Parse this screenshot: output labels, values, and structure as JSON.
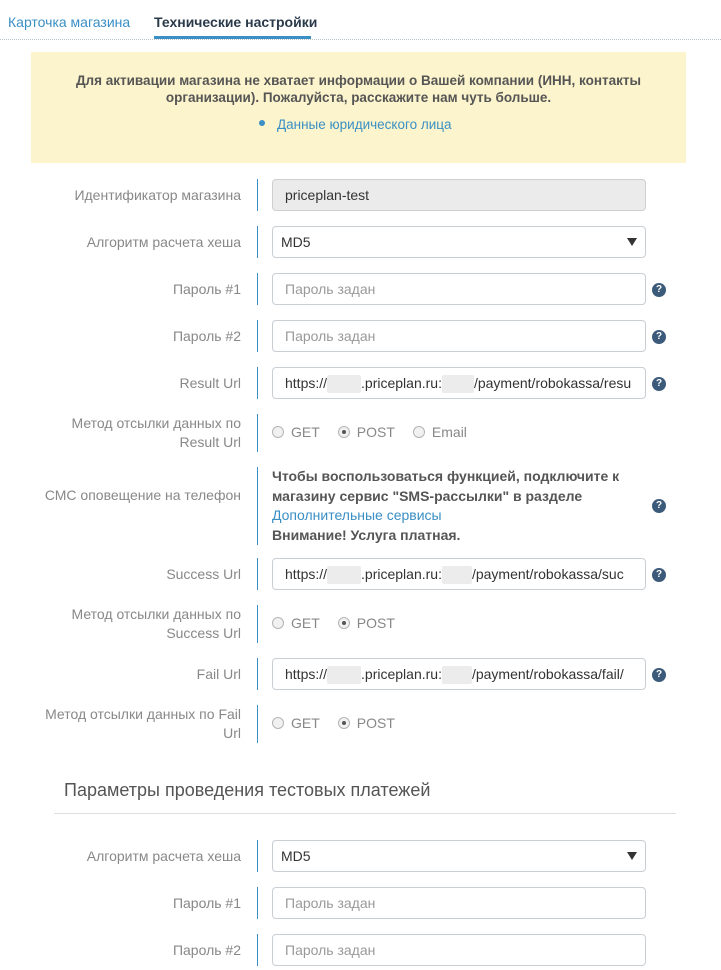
{
  "tabs": [
    {
      "label": "Карточка магазина",
      "active": false
    },
    {
      "label": "Технические настройки",
      "active": true
    }
  ],
  "alert": {
    "text": "Для активации магазина не хватает информации о Вашей компании (ИНН, контакты организации). Пожалуйста, расскажите нам чуть больше.",
    "link": "Данные юридического лица"
  },
  "form": {
    "shop_id": {
      "label": "Идентификатор магазина",
      "value": "priceplan-test"
    },
    "hash_algo": {
      "label": "Алгоритм расчета хеша",
      "value": "MD5"
    },
    "password1": {
      "label": "Пароль #1",
      "placeholder": "Пароль задан"
    },
    "password2": {
      "label": "Пароль #2",
      "placeholder": "Пароль задан"
    },
    "result_url": {
      "label": "Result Url",
      "prefix": "https://",
      "mid": ".priceplan.ru:",
      "suffix": "/payment/robokassa/resu"
    },
    "result_method": {
      "label": "Метод отсылки данных по Result Url",
      "options": [
        "GET",
        "POST",
        "Email"
      ],
      "selected": "POST"
    },
    "sms": {
      "label": "СМС оповещение на телефон",
      "text": "Чтобы воспользоваться функцией, подключите к магазину сервис \"SMS-рассылки\" в разделе",
      "link": "Дополнительные сервисы",
      "warning": "Внимание! Услуга платная."
    },
    "success_url": {
      "label": "Success Url",
      "prefix": "https://",
      "mid": ".priceplan.ru:",
      "suffix": "/payment/robokassa/suc"
    },
    "success_method": {
      "label": "Метод отсылки данных по Success Url",
      "options": [
        "GET",
        "POST"
      ],
      "selected": "POST"
    },
    "fail_url": {
      "label": "Fail Url",
      "prefix": "https://",
      "mid": ".priceplan.ru:",
      "suffix": "/payment/robokassa/fail/"
    },
    "fail_method": {
      "label": "Метод отсылки данных по Fail Url",
      "options": [
        "GET",
        "POST"
      ],
      "selected": "POST"
    }
  },
  "test_section": {
    "title": "Параметры проведения тестовых платежей",
    "hash_algo": {
      "label": "Алгоритм расчета хеша",
      "value": "MD5"
    },
    "password1": {
      "label": "Пароль #1",
      "placeholder": "Пароль задан"
    },
    "password2": {
      "label": "Пароль #2",
      "placeholder": "Пароль задан"
    }
  },
  "icons": {
    "help": "question-circle-icon",
    "caret": "caret-down-icon"
  },
  "colors": {
    "accent": "#3a8fc4",
    "alert_bg": "#fcf4cc",
    "help_icon": "#3c5a7a"
  }
}
